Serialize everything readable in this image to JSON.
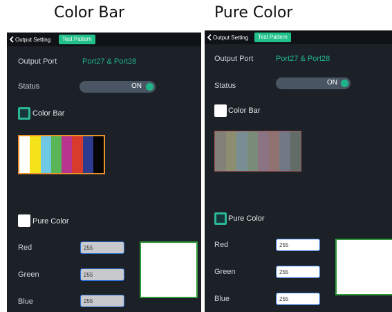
{
  "captions": {
    "left": "Color Bar",
    "right": "Pure Color"
  },
  "colors": {
    "accent": "#22c08a",
    "panel_bg": "#1c2128",
    "topbar_bg": "#0f1216"
  },
  "left": {
    "back_label": "Output Setting",
    "tab_label": "Test Pattern",
    "output_port_label": "Output Port",
    "output_port_value": "Port27  &  Port28",
    "status_label": "Status",
    "status_value": "ON",
    "color_bar_label": "Color Bar",
    "color_bar_checked": true,
    "bars": [
      "#ffffff",
      "#f4e21a",
      "#6ec8e4",
      "#59b555",
      "#b7348f",
      "#d83a2b",
      "#2c3b8f",
      "#050505"
    ],
    "pure_color_label": "Pure Color",
    "pure_color_checked": false,
    "red_label": "Red",
    "red_value": "255",
    "green_label": "Green",
    "green_value": "255",
    "blue_label": "Blue",
    "blue_value": "255"
  },
  "right": {
    "back_label": "Output Setting",
    "tab_label": "Test Pattern",
    "output_port_label": "Output Port",
    "output_port_value": "Port27  &  Port28",
    "status_label": "Status",
    "status_value": "ON",
    "color_bar_label": "Color Bar",
    "color_bar_checked": false,
    "bars": [
      "#8c8c80",
      "#9a9a78",
      "#849aa0",
      "#839882",
      "#977e8e",
      "#9c7b78",
      "#7d8292",
      "#6a7670"
    ],
    "pure_color_label": "Pure Color",
    "pure_color_checked": true,
    "red_label": "Red",
    "red_value": "255",
    "green_label": "Green",
    "green_value": "255",
    "blue_label": "Blue",
    "blue_value": "255"
  }
}
